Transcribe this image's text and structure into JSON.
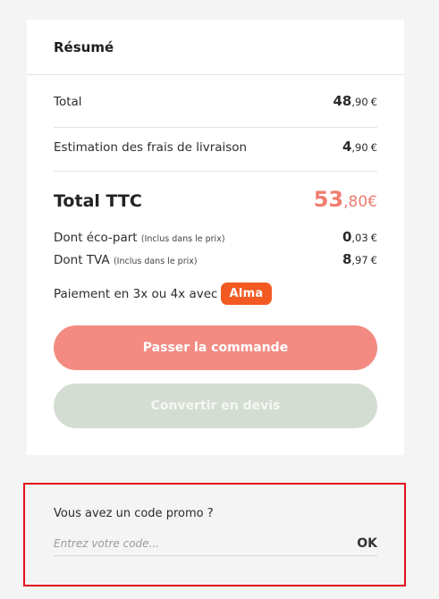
{
  "summary": {
    "title": "Résumé",
    "total": {
      "label": "Total",
      "int": "48",
      "cents": ",90",
      "currency": "€"
    },
    "shipping": {
      "label": "Estimation des frais de livraison",
      "int": "4",
      "cents": ",90",
      "currency": "€"
    },
    "total_ttc": {
      "label": "Total TTC",
      "int": "53",
      "cents": ",80",
      "currency": "€"
    },
    "eco_part": {
      "label": "Dont éco-part",
      "note": "(Inclus dans le prix)",
      "int": "0",
      "cents": ",03",
      "currency": "€"
    },
    "tva": {
      "label": "Dont TVA",
      "note": "(Inclus dans le prix)",
      "int": "8",
      "cents": ",97",
      "currency": "€"
    },
    "payment_text": "Paiement en 3x ou 4x avec",
    "alma_badge": "Alma",
    "order_button": "Passer la commande",
    "quote_button": "Convertir en devis"
  },
  "promo": {
    "title": "Vous avez un code promo ?",
    "placeholder": "Entrez votre code...",
    "value": "",
    "ok_label": "OK"
  },
  "colors": {
    "accent": "#ee7d70",
    "order_button": "#f38b82",
    "quote_button": "#d4ddd2",
    "alma": "#f25a22",
    "highlight_border": "#e2101a"
  }
}
